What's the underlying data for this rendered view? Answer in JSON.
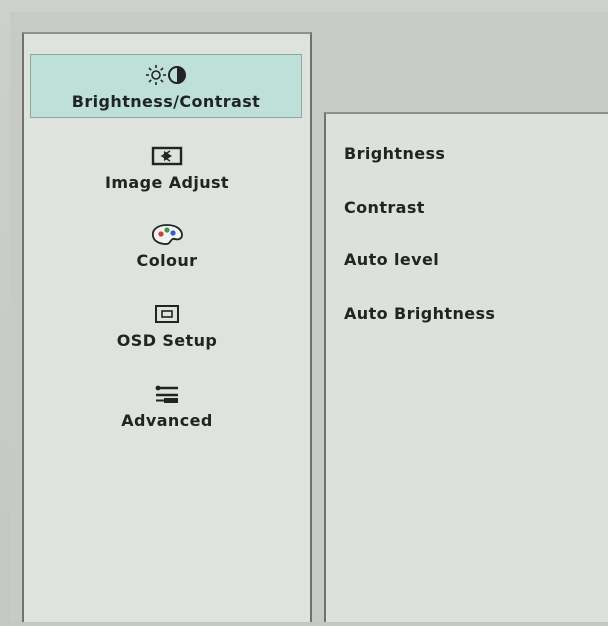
{
  "sidebar": {
    "items": [
      {
        "label": "Brightness/Contrast",
        "icon": "brightness-contrast-icon",
        "selected": true
      },
      {
        "label": "Image Adjust",
        "icon": "image-adjust-icon"
      },
      {
        "label": "Colour",
        "icon": "colour-palette-icon"
      },
      {
        "label": "OSD Setup",
        "icon": "osd-setup-icon"
      },
      {
        "label": "Advanced",
        "icon": "advanced-settings-icon"
      }
    ]
  },
  "submenu": {
    "options": [
      {
        "label": "Brightness"
      },
      {
        "label": "Contrast"
      },
      {
        "label": "Auto level"
      },
      {
        "label": "Auto Brightness"
      }
    ]
  },
  "colors": {
    "selected_highlight": "#bfe0d8",
    "panel_background": "#dfe3de",
    "text": "#202422"
  }
}
